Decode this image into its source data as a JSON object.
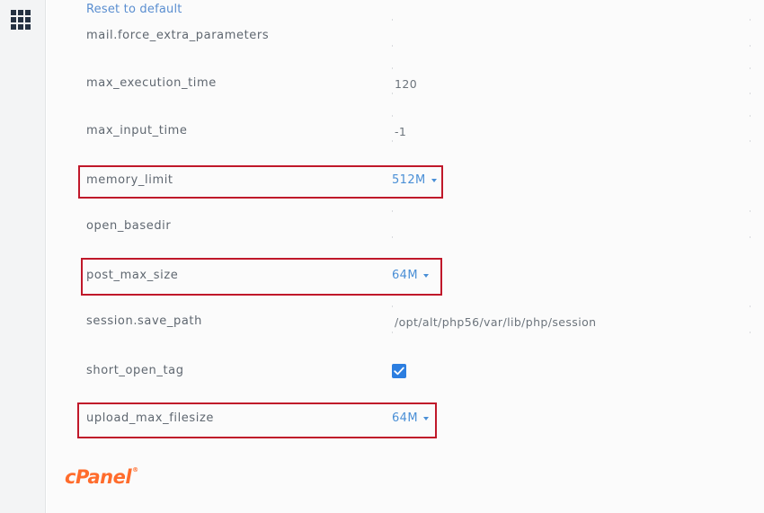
{
  "sidebar": {
    "menu_icon": "grid-icon"
  },
  "reset_link": "Reset to default",
  "settings": [
    {
      "key": "mail_force",
      "label": "mail.force_extra_parameters",
      "value": ""
    },
    {
      "key": "max_exec",
      "label": "max_execution_time",
      "value": "120"
    },
    {
      "key": "max_input",
      "label": "max_input_time",
      "value": "-1"
    },
    {
      "key": "memory_limit",
      "label": "memory_limit",
      "value": "512M",
      "control": "dropdown",
      "highlighted": true
    },
    {
      "key": "open_basedir",
      "label": "open_basedir",
      "value": ""
    },
    {
      "key": "post_max",
      "label": "post_max_size",
      "value": "64M",
      "control": "dropdown",
      "highlighted": true
    },
    {
      "key": "session_path",
      "label": "session.save_path",
      "value": "/opt/alt/php56/var/lib/php/session"
    },
    {
      "key": "short_open_tag",
      "label": "short_open_tag",
      "value": "checked",
      "control": "checkbox"
    },
    {
      "key": "upload_max",
      "label": "upload_max_filesize",
      "value": "64M",
      "control": "dropdown",
      "highlighted": true
    }
  ],
  "logo": {
    "text": "cPanel",
    "mark": "®"
  },
  "colors": {
    "accent": "#4a8fd6",
    "highlight_border": "#c0182a",
    "checkbox": "#2c7ee0",
    "logo": "#ff6c2c",
    "sidebar_bg": "#f3f4f5"
  }
}
